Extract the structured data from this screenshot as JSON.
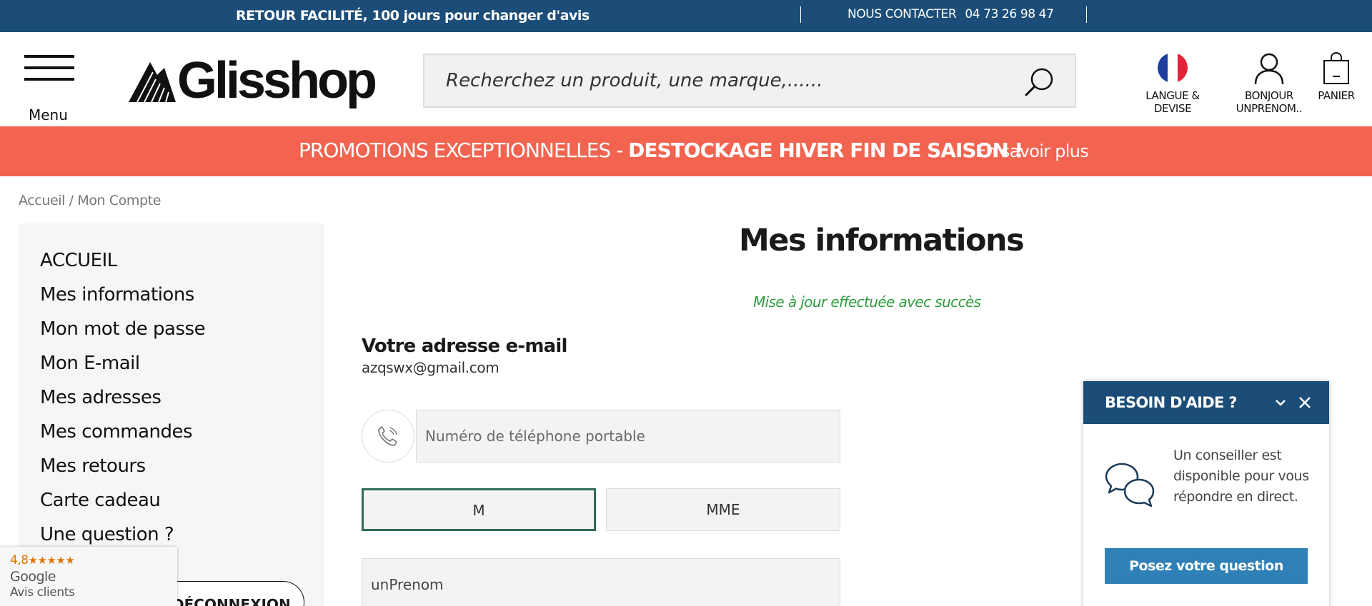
{
  "topbar": {
    "promo": "RETOUR FACILITÉ, 100 jours pour changer d'avis",
    "contact_label": "NOUS CONTACTER",
    "contact_phone": "04 73 26 98 47"
  },
  "header": {
    "menu_label": "Menu",
    "logo_text": "Glisshop",
    "search_placeholder": "Recherchez un produit, une marque,......",
    "lang_label": "LANGUE & DEVISE",
    "account_line1": "BONJOUR",
    "account_line2": "UNPRENOM..",
    "cart_label": "PANIER"
  },
  "banner": {
    "text_normal": "PROMOTIONS EXCEPTIONNELLES - ",
    "text_bold": "DESTOCKAGE HIVER FIN DE SAISON !",
    "more": "En savoir plus"
  },
  "breadcrumb": {
    "home": "Accueil",
    "separator": " / ",
    "current": "Mon Compte"
  },
  "sidebar": {
    "items": [
      "ACCUEIL",
      "Mes informations",
      "Mon mot de passe",
      "Mon E-mail",
      "Mes adresses",
      "Mes commandes",
      "Mes retours",
      "Carte cadeau",
      "Une question ?"
    ],
    "logout_label": "DÉCONNEXION"
  },
  "reviews": {
    "rating": "4,8",
    "stars": "★★★★★",
    "name": "Google",
    "sub": "Avis clients"
  },
  "main": {
    "title": "Mes informations",
    "success": "Mise à jour effectuée avec succès",
    "email_heading": "Votre adresse e-mail",
    "email_value": "azqswx@gmail.com",
    "phone_placeholder": "Numéro de téléphone portable",
    "civility_m": "M",
    "civility_mme": "MME",
    "firstname_value": "unPrenom"
  },
  "help": {
    "title": "BESOIN D'AIDE ?",
    "text": "Un conseiller est disponible pour vous répondre en direct.",
    "button": "Posez votre question"
  },
  "colors": {
    "topbar": "#1b4d78",
    "banner": "#f26450",
    "success": "#2e9d3e",
    "help_button": "#2e80b6",
    "selected_border": "#2f6b5a"
  }
}
